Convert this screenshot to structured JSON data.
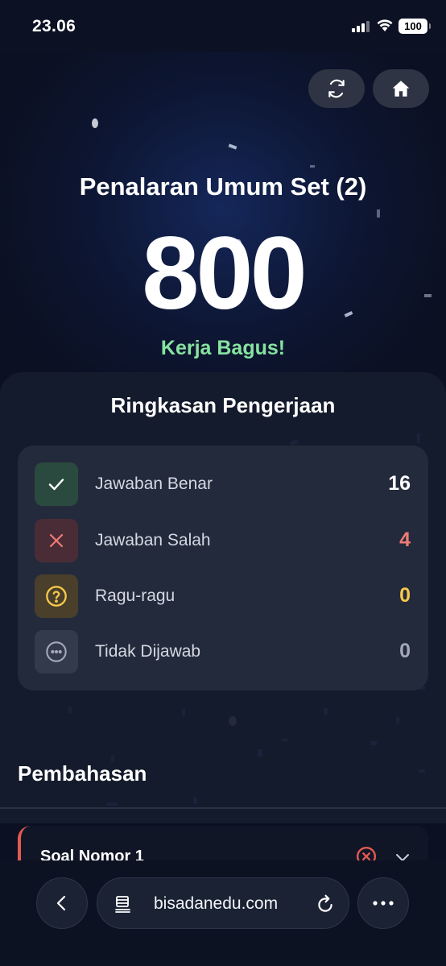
{
  "status_bar": {
    "time": "23.06",
    "battery": "100"
  },
  "result": {
    "title": "Penalaran Umum Set (2)",
    "score": "800",
    "praise": "Kerja Bagus!"
  },
  "summary": {
    "title": "Ringkasan Pengerjaan",
    "rows": [
      {
        "label": "Jawaban Benar",
        "value": "16",
        "icon": "check-icon",
        "color": "#ffffff"
      },
      {
        "label": "Jawaban Salah",
        "value": "4",
        "icon": "x-icon",
        "color": "#ef7b75"
      },
      {
        "label": "Ragu-ragu",
        "value": "0",
        "icon": "question-circle-icon",
        "color": "#f5c84a"
      },
      {
        "label": "Tidak Dijawab",
        "value": "0",
        "icon": "ellipsis-circle-icon",
        "color": "#a3a9b8"
      }
    ]
  },
  "discussion": {
    "title": "Pembahasan",
    "first_question": {
      "title": "Soal Nomor 1",
      "status_icon": "x-circle-icon",
      "accent": "#e35a52"
    }
  },
  "browser": {
    "url": "bisadanedu.com"
  },
  "colors": {
    "background": "#0b1022",
    "praise": "#86e3a0",
    "wrong": "#ef7b75",
    "doubt": "#f5c84a"
  }
}
